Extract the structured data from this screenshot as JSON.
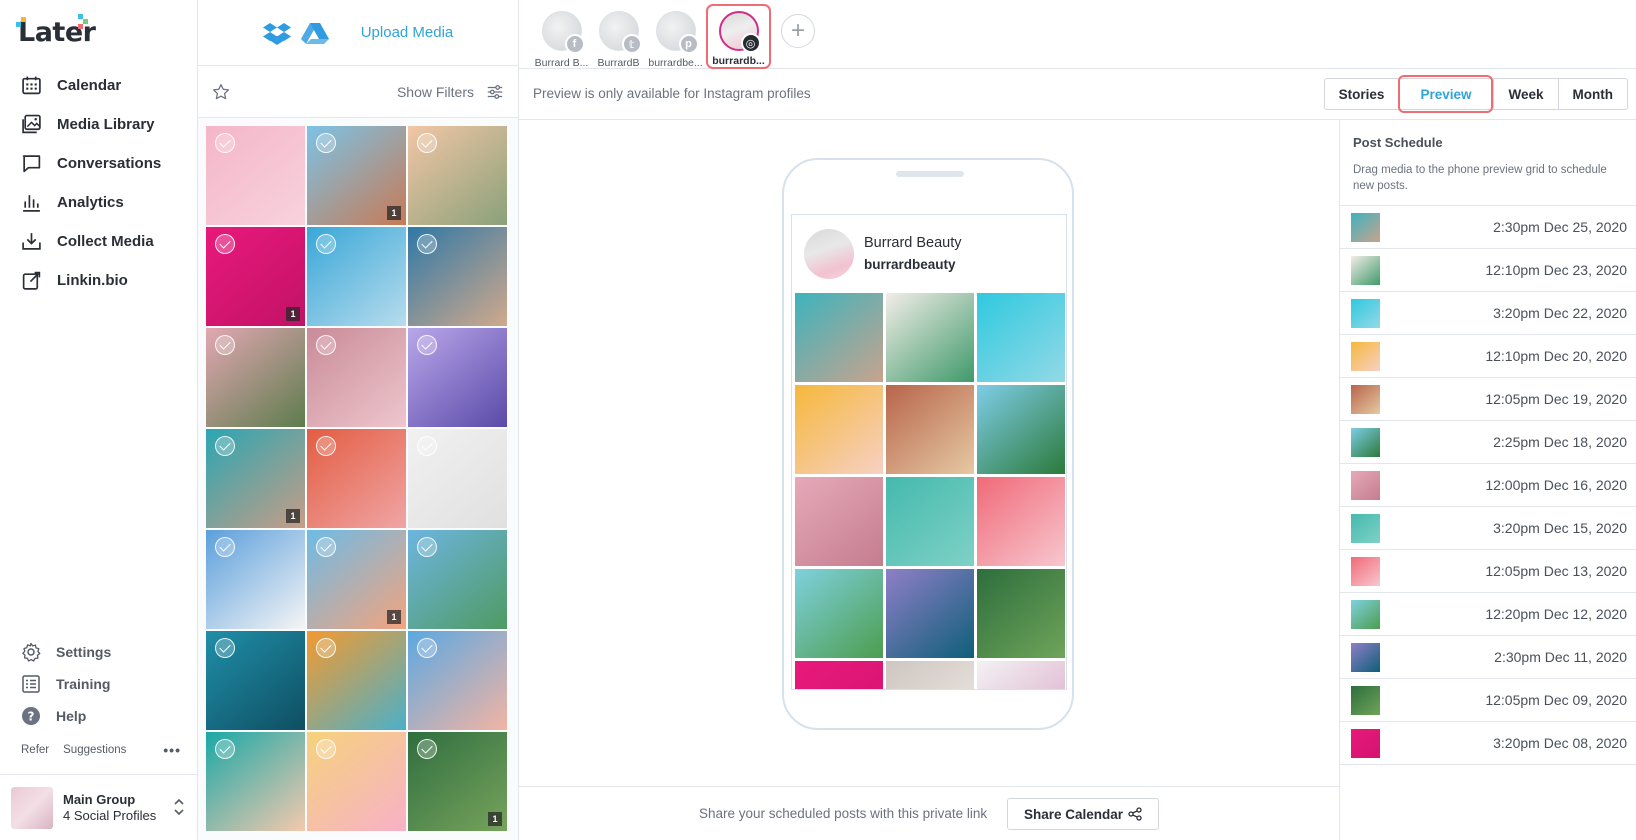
{
  "nav": {
    "logo_text": "Later",
    "items": [
      {
        "label": "Calendar"
      },
      {
        "label": "Media Library"
      },
      {
        "label": "Conversations"
      },
      {
        "label": "Analytics"
      },
      {
        "label": "Collect Media"
      },
      {
        "label": "Linkin.bio"
      }
    ],
    "bottom": [
      {
        "label": "Settings"
      },
      {
        "label": "Training"
      },
      {
        "label": "Help"
      }
    ],
    "refer": "Refer",
    "suggestions": "Suggestions",
    "more": "•••",
    "group_name": "Main Group",
    "group_sub": "4 Social Profiles"
  },
  "media": {
    "upload_label": "Upload Media",
    "show_filters": "Show Filters",
    "tiles": [
      {
        "c1": "#f4b6c9",
        "c2": "#f8d2dd",
        "count": ""
      },
      {
        "c1": "#7cc3e6",
        "c2": "#c77a55",
        "count": "1"
      },
      {
        "c1": "#f2c6a6",
        "c2": "#8aa17a",
        "count": ""
      },
      {
        "c1": "#e8197b",
        "c2": "#c21267",
        "count": "1"
      },
      {
        "c1": "#39a7d8",
        "c2": "#b7dced",
        "count": ""
      },
      {
        "c1": "#2f78a6",
        "c2": "#d0a98c",
        "count": ""
      },
      {
        "c1": "#e2a7b3",
        "c2": "#5d7c4c",
        "count": ""
      },
      {
        "c1": "#c98b98",
        "c2": "#eec6cd",
        "count": ""
      },
      {
        "c1": "#b9a7ea",
        "c2": "#5a4aa8",
        "count": ""
      },
      {
        "c1": "#2aa6b2",
        "c2": "#c79d86",
        "count": "1"
      },
      {
        "c1": "#e35d42",
        "c2": "#f0a5a5",
        "count": ""
      },
      {
        "c1": "#f1f1f1",
        "c2": "#e0e0e0",
        "count": ""
      },
      {
        "c1": "#5b9fdc",
        "c2": "#f5f5f5",
        "count": ""
      },
      {
        "c1": "#6dbbe6",
        "c2": "#f4a37d",
        "count": "1"
      },
      {
        "c1": "#6db5e0",
        "c2": "#4f9a63",
        "count": ""
      },
      {
        "c1": "#1f8fa8",
        "c2": "#0f4e62",
        "count": ""
      },
      {
        "c1": "#f39a2f",
        "c2": "#4bb0c9",
        "count": ""
      },
      {
        "c1": "#5ba8e2",
        "c2": "#f2b4a3",
        "count": ""
      },
      {
        "c1": "#1aa8a6",
        "c2": "#f5c9ae",
        "count": ""
      },
      {
        "c1": "#f6d27c",
        "c2": "#f7b1c8",
        "count": ""
      },
      {
        "c1": "#2f6e3f",
        "c2": "#77a35c",
        "count": "1"
      }
    ]
  },
  "profiles": [
    {
      "name": "Burrard B...",
      "network": "f",
      "badge_color": "#b8bcc4"
    },
    {
      "name": "BurrardB",
      "network": "t",
      "badge_color": "#b8bcc4"
    },
    {
      "name": "burrardbe...",
      "network": "p",
      "badge_color": "#b8bcc4"
    },
    {
      "name": "burrardb...",
      "network": "ig",
      "badge_color": "#262b33"
    }
  ],
  "subbar": {
    "message": "Preview is only available for Instagram profiles",
    "tabs": [
      {
        "label": "Stories"
      },
      {
        "label": "Preview"
      },
      {
        "label": "Week"
      },
      {
        "label": "Month"
      }
    ]
  },
  "instagram": {
    "display_name": "Burrard Beauty",
    "handle": "burrardbeauty",
    "grid": [
      {
        "c1": "#3db3bd",
        "c2": "#c8a38d"
      },
      {
        "c1": "#f2ede8",
        "c2": "#3f9a6a"
      },
      {
        "c1": "#2fc9df",
        "c2": "#93d9e6"
      },
      {
        "c1": "#f5b83b",
        "c2": "#f7d0c4"
      },
      {
        "c1": "#b8654b",
        "c2": "#e5c9a3"
      },
      {
        "c1": "#7ecde8",
        "c2": "#2c7a3a"
      },
      {
        "c1": "#e6a9b8",
        "c2": "#c47d8f"
      },
      {
        "c1": "#45b9ad",
        "c2": "#7fd1c6"
      },
      {
        "c1": "#f06a78",
        "c2": "#f7c7cf"
      },
      {
        "c1": "#7fd1de",
        "c2": "#4c9d4e"
      },
      {
        "c1": "#8f7fc7",
        "c2": "#0e5f79"
      },
      {
        "c1": "#2d6e3c",
        "c2": "#6fa45a"
      },
      {
        "c1": "#e8197b",
        "c2": "#d3146f"
      },
      {
        "c1": "#cfc6c0",
        "c2": "#efeae6"
      },
      {
        "c1": "#f3f1f4",
        "c2": "#d9a6c4"
      }
    ]
  },
  "share": {
    "text": "Share your scheduled posts with this private link",
    "button": "Share Calendar"
  },
  "schedule": {
    "title": "Post Schedule",
    "subtitle": "Drag media to the phone preview grid to schedule new posts.",
    "posts": [
      {
        "date": "2:30pm Dec 25, 2020",
        "c1": "#3db3bd",
        "c2": "#c8a38d"
      },
      {
        "date": "12:10pm Dec 23, 2020",
        "c1": "#f2ede8",
        "c2": "#3f9a6a"
      },
      {
        "date": "3:20pm Dec 22, 2020",
        "c1": "#2fc9df",
        "c2": "#93d9e6"
      },
      {
        "date": "12:10pm Dec 20, 2020",
        "c1": "#f5b83b",
        "c2": "#f7d0c4"
      },
      {
        "date": "12:05pm Dec 19, 2020",
        "c1": "#b8654b",
        "c2": "#e5c9a3"
      },
      {
        "date": "2:25pm Dec 18, 2020",
        "c1": "#7ecde8",
        "c2": "#2c7a3a"
      },
      {
        "date": "12:00pm Dec 16, 2020",
        "c1": "#e6a9b8",
        "c2": "#c47d8f"
      },
      {
        "date": "3:20pm Dec 15, 2020",
        "c1": "#45b9ad",
        "c2": "#7fd1c6"
      },
      {
        "date": "12:05pm Dec 13, 2020",
        "c1": "#f06a78",
        "c2": "#f7c7cf"
      },
      {
        "date": "12:20pm Dec 12, 2020",
        "c1": "#7fd1de",
        "c2": "#4c9d4e"
      },
      {
        "date": "2:30pm Dec 11, 2020",
        "c1": "#8f7fc7",
        "c2": "#0e5f79"
      },
      {
        "date": "12:05pm Dec 09, 2020",
        "c1": "#2d6e3c",
        "c2": "#6fa45a"
      },
      {
        "date": "3:20pm Dec 08, 2020",
        "c1": "#e8197b",
        "c2": "#d3146f"
      }
    ]
  },
  "colors": {
    "accent": "#2fa4d9",
    "highlight": "#ee6d75",
    "instagram_ring": "#d12d8b"
  }
}
